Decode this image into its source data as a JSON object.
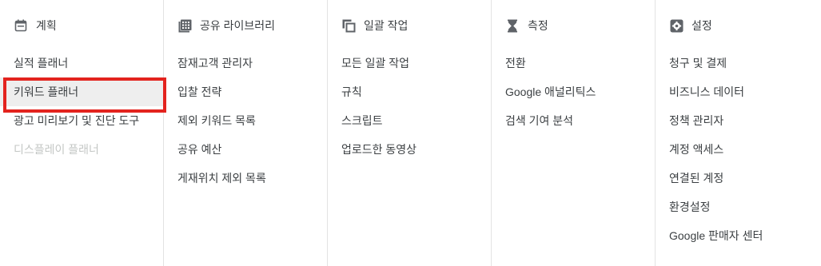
{
  "columns": [
    {
      "id": "planning",
      "title": "계획",
      "icon": "calendar-icon",
      "items": [
        {
          "label": "실적 플래너",
          "state": "normal"
        },
        {
          "label": "키워드 플래너",
          "state": "selected"
        },
        {
          "label": "광고 미리보기 및 진단 도구",
          "state": "normal"
        },
        {
          "label": "디스플레이 플래너",
          "state": "disabled"
        }
      ]
    },
    {
      "id": "shared-library",
      "title": "공유 라이브러리",
      "icon": "library-icon",
      "items": [
        {
          "label": "잠재고객 관리자"
        },
        {
          "label": "입찰 전략"
        },
        {
          "label": "제외 키워드 목록"
        },
        {
          "label": "공유 예산"
        },
        {
          "label": "게재위치 제외 목록"
        }
      ]
    },
    {
      "id": "bulk-actions",
      "title": "일괄 작업",
      "icon": "copy-stack-icon",
      "items": [
        {
          "label": "모든 일괄 작업"
        },
        {
          "label": "규칙"
        },
        {
          "label": "스크립트"
        },
        {
          "label": "업로드한 동영상"
        }
      ]
    },
    {
      "id": "measurement",
      "title": "측정",
      "icon": "hourglass-icon",
      "items": [
        {
          "label": "전환"
        },
        {
          "label": "Google 애널리틱스"
        },
        {
          "label": "검색 기여 분석"
        }
      ]
    },
    {
      "id": "settings",
      "title": "설정",
      "icon": "gear-icon",
      "items": [
        {
          "label": "청구 및 결제"
        },
        {
          "label": "비즈니스 데이터"
        },
        {
          "label": "정책 관리자"
        },
        {
          "label": "계정 액세스"
        },
        {
          "label": "연결된 계정"
        },
        {
          "label": "환경설정"
        },
        {
          "label": "Google 판매자 센터"
        }
      ]
    }
  ],
  "colors": {
    "text": "#3c4043",
    "icon": "#5f6368",
    "disabled": "#c4c7c5",
    "selected_bg": "#eeeeee",
    "highlight_border": "#e3231e",
    "divider": "#e3e3e3"
  }
}
